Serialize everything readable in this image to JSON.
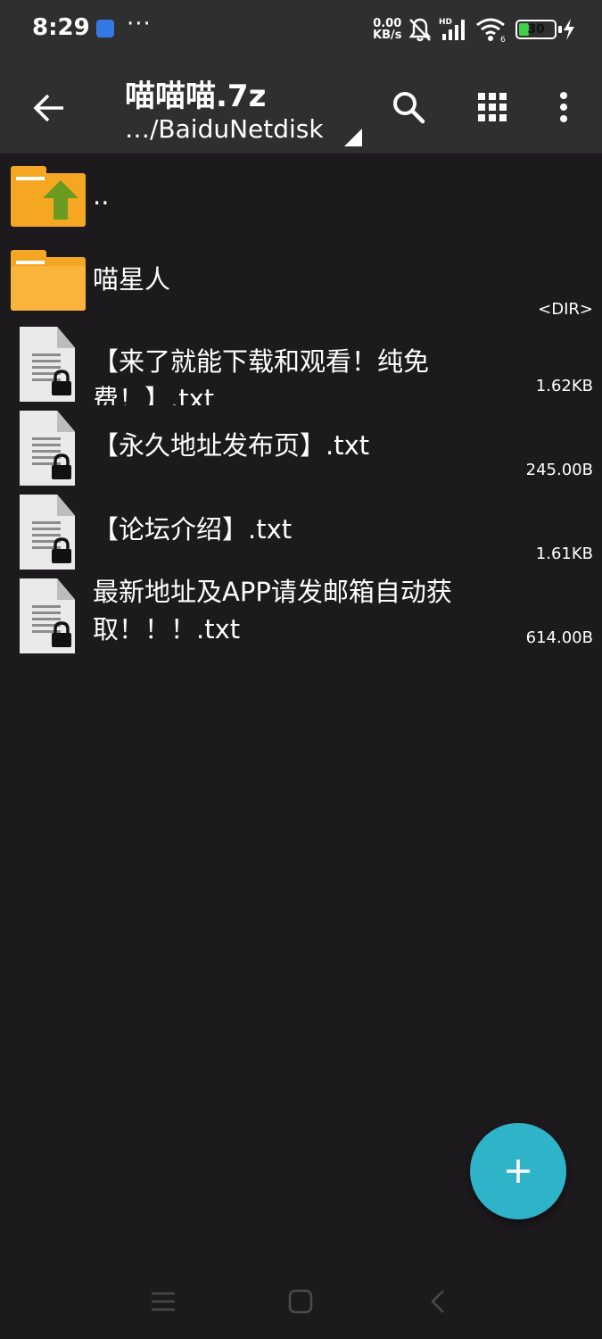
{
  "status_bar": {
    "time": "8:29",
    "overflow_dots": "···",
    "net_speed_value": "0.00",
    "net_speed_unit": "KB/s",
    "signal_label": "HD",
    "wifi_label": "6",
    "battery_level": "30"
  },
  "toolbar": {
    "title": "喵喵喵.7z",
    "path": "…/BaiduNetdisk"
  },
  "files": [
    {
      "name": "..",
      "type": "parent-folder",
      "size": ""
    },
    {
      "name": "喵星人",
      "type": "folder",
      "size": "<DIR>"
    },
    {
      "name": "【来了就能下载和观看！纯免费！】.txt",
      "type": "locked-text",
      "size": "1.62KB"
    },
    {
      "name": "【永久地址发布页】.txt",
      "type": "locked-text",
      "size": "245.00B"
    },
    {
      "name": "【论坛介绍】.txt",
      "type": "locked-text",
      "size": "1.61KB"
    },
    {
      "name": "最新地址及APP请发邮箱自动获取！！！.txt",
      "type": "locked-text",
      "size": "614.00B"
    }
  ],
  "colors": {
    "background": "#1c1a1d",
    "toolbar": "#2f2f2f",
    "folder": "#f5a623",
    "up_arrow": "#6a9a1f",
    "fab": "#2fb3c8",
    "battery": "#3fcf4a"
  },
  "icons": {
    "back": "arrow-left-icon",
    "search": "search-icon",
    "grid": "grid-icon",
    "more": "more-vert-icon",
    "fab": "plus-icon"
  }
}
